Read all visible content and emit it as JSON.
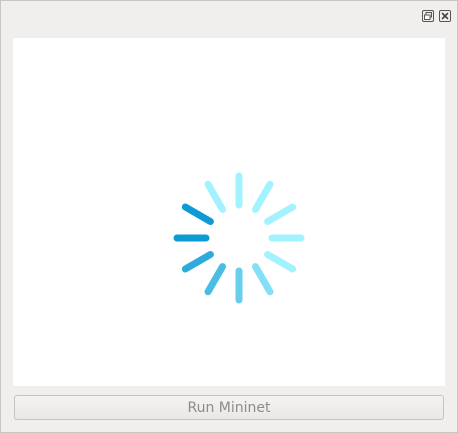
{
  "window": {
    "float_icon": "restore-window-icon",
    "close_icon": "close-window-icon"
  },
  "loading_spinner": {
    "icon": "loading-spinner-icon",
    "spoke_count": 12,
    "active_color": "#0e9ad2",
    "inactive_color": "#a2f2ff"
  },
  "footer": {
    "run_label": "Run Mininet"
  }
}
